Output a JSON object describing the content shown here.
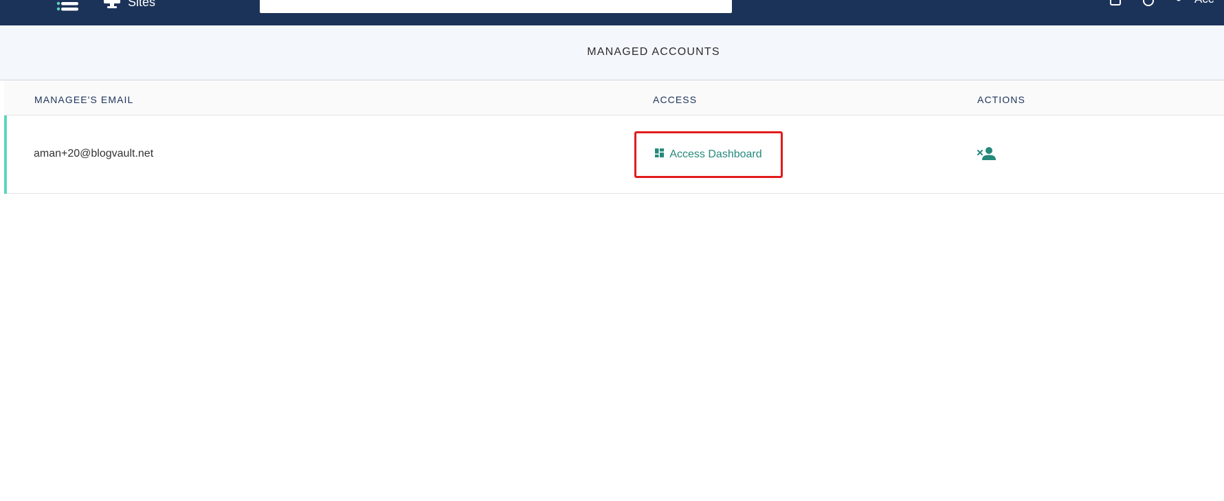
{
  "topbar": {
    "sites_label": "Sites",
    "search_value": "",
    "right_label": "Acc"
  },
  "section": {
    "title": "MANAGED ACCOUNTS"
  },
  "table": {
    "columns": [
      "MANAGEE'S EMAIL",
      "ACCESS",
      "ACTIONS"
    ],
    "rows": [
      {
        "email": "aman+20@blogvault.net",
        "access_label": "Access Dashboard",
        "action_icon": "remove-user-icon"
      }
    ]
  },
  "colors": {
    "topbar": "#1c3359",
    "accent": "#25897b",
    "row_marker": "#5ad7bf",
    "highlight": "#e21b1b"
  },
  "icons": {
    "menu": "menu-list-icon",
    "sites": "monitor-icon",
    "access": "dashboard-icon",
    "action": "remove-user-icon"
  }
}
